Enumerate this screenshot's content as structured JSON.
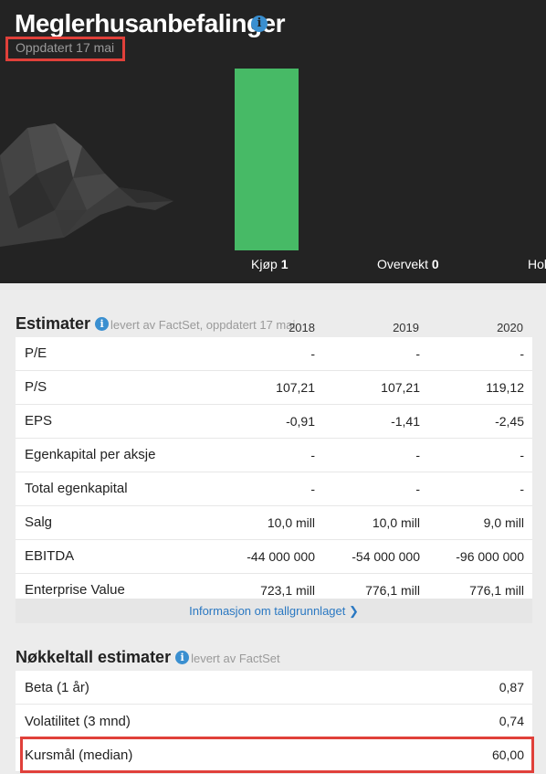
{
  "recommendations": {
    "title": "Meglerhusanbefalinger",
    "updated": "Oppdatert 17 mai",
    "items": [
      {
        "label": "Kjøp",
        "count": "1",
        "color": "#47ba66"
      },
      {
        "label": "Overvekt",
        "count": "0"
      },
      {
        "label": "Hol",
        "count": ""
      }
    ]
  },
  "estimates": {
    "title": "Estimater",
    "subtitle": "levert av FactSet, oppdatert 17 mai",
    "years": [
      "2018",
      "2019",
      "2020"
    ],
    "rows": [
      {
        "label": "P/E",
        "values": [
          "-",
          "-",
          "-"
        ]
      },
      {
        "label": "P/S",
        "values": [
          "107,21",
          "107,21",
          "119,12"
        ]
      },
      {
        "label": "EPS",
        "values": [
          "-0,91",
          "-1,41",
          "-2,45"
        ]
      },
      {
        "label": "Egenkapital per aksje",
        "values": [
          "-",
          "-",
          "-"
        ]
      },
      {
        "label": "Total egenkapital",
        "values": [
          "-",
          "-",
          "-"
        ]
      },
      {
        "label": "Salg",
        "values": [
          "10,0 mill",
          "10,0 mill",
          "9,0 mill"
        ]
      },
      {
        "label": "EBITDA",
        "values": [
          "-44 000 000",
          "-54 000 000",
          "-96 000 000"
        ]
      },
      {
        "label": "Enterprise Value",
        "values": [
          "723,1 mill",
          "776,1 mill",
          "776,1 mill"
        ]
      }
    ],
    "info_link": "Informasjon om tallgrunnlaget ❯"
  },
  "key_estimates": {
    "title": "Nøkkeltall estimater",
    "subtitle": "levert av FactSet",
    "rows": [
      {
        "label": "Beta (1 år)",
        "value": "0,87"
      },
      {
        "label": "Volatilitet (3 mnd)",
        "value": "0,74"
      },
      {
        "label": "Kursmål (median)",
        "value": "60,00"
      }
    ]
  },
  "colors": {
    "accent_link": "#2a78c2",
    "highlight_border": "#e0403a",
    "panel_bg": "#232323"
  },
  "icons": [
    "info-icon",
    "bull-illustration"
  ]
}
